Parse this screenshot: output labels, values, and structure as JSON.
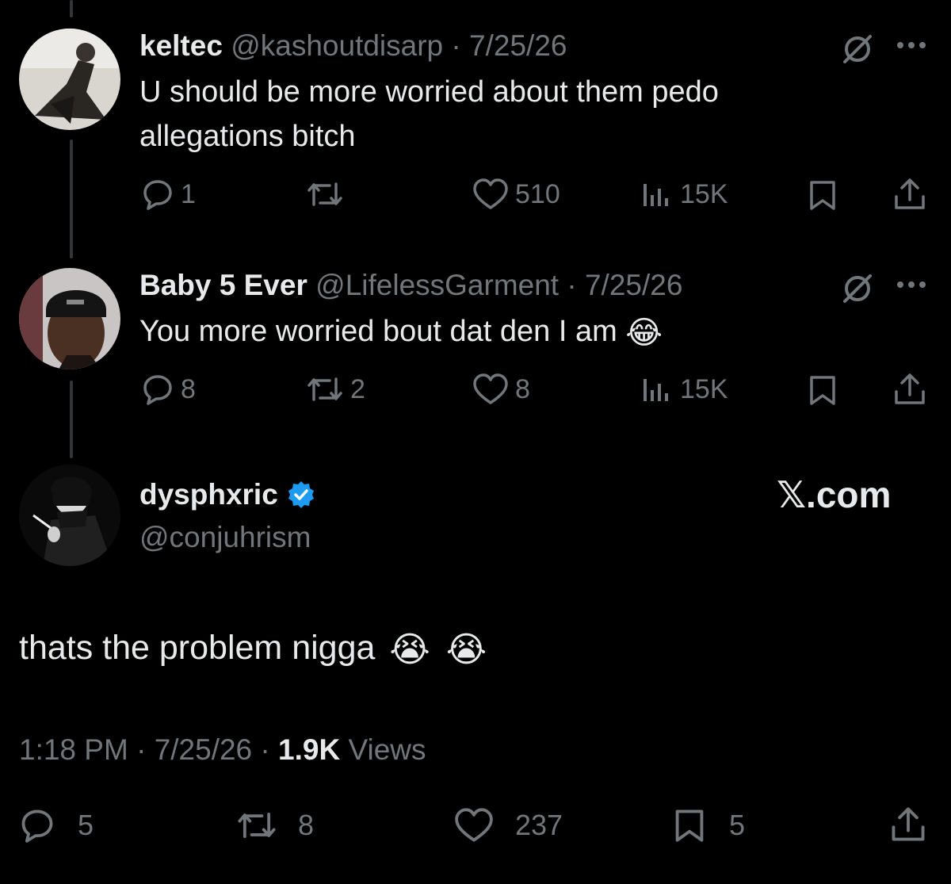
{
  "tweets": [
    {
      "name": "keltec",
      "handle": "@kashoutdisarp",
      "sep": " · ",
      "date": "7/25/26",
      "text": "U should be more worried about them pedo allegations bitch",
      "replies": "1",
      "retweets": "",
      "likes": "510",
      "views": "15K"
    },
    {
      "name": "Baby 5 Ever",
      "handle": "@LifelessGarment",
      "sep": " · ",
      "date": "7/25/26",
      "text": "You more worried bout dat den I am",
      "emoji": "😂",
      "replies": "8",
      "retweets": "2",
      "likes": "8",
      "views": "15K"
    }
  ],
  "main": {
    "name": "dysphxric",
    "handle": "@conjuhrism",
    "brand": "𝕏.com",
    "text": "thats the problem nigga",
    "emojis": [
      "😭",
      "😭"
    ],
    "time": "1:18 PM",
    "sep": " · ",
    "date": "7/25/26",
    "views_count": "1.9K",
    "views_label": "Views",
    "replies": "5",
    "retweets": "8",
    "likes": "237",
    "bookmarks": "5"
  },
  "colors": {
    "background": "#000000",
    "text": "#e7e9ea",
    "secondary": "#71767b",
    "verified": "#1d9bf0"
  },
  "icons": [
    "reply-icon",
    "retweet-icon",
    "like-icon",
    "views-icon",
    "bookmark-icon",
    "share-icon",
    "grok-icon",
    "more-icon",
    "verified-badge-icon"
  ]
}
